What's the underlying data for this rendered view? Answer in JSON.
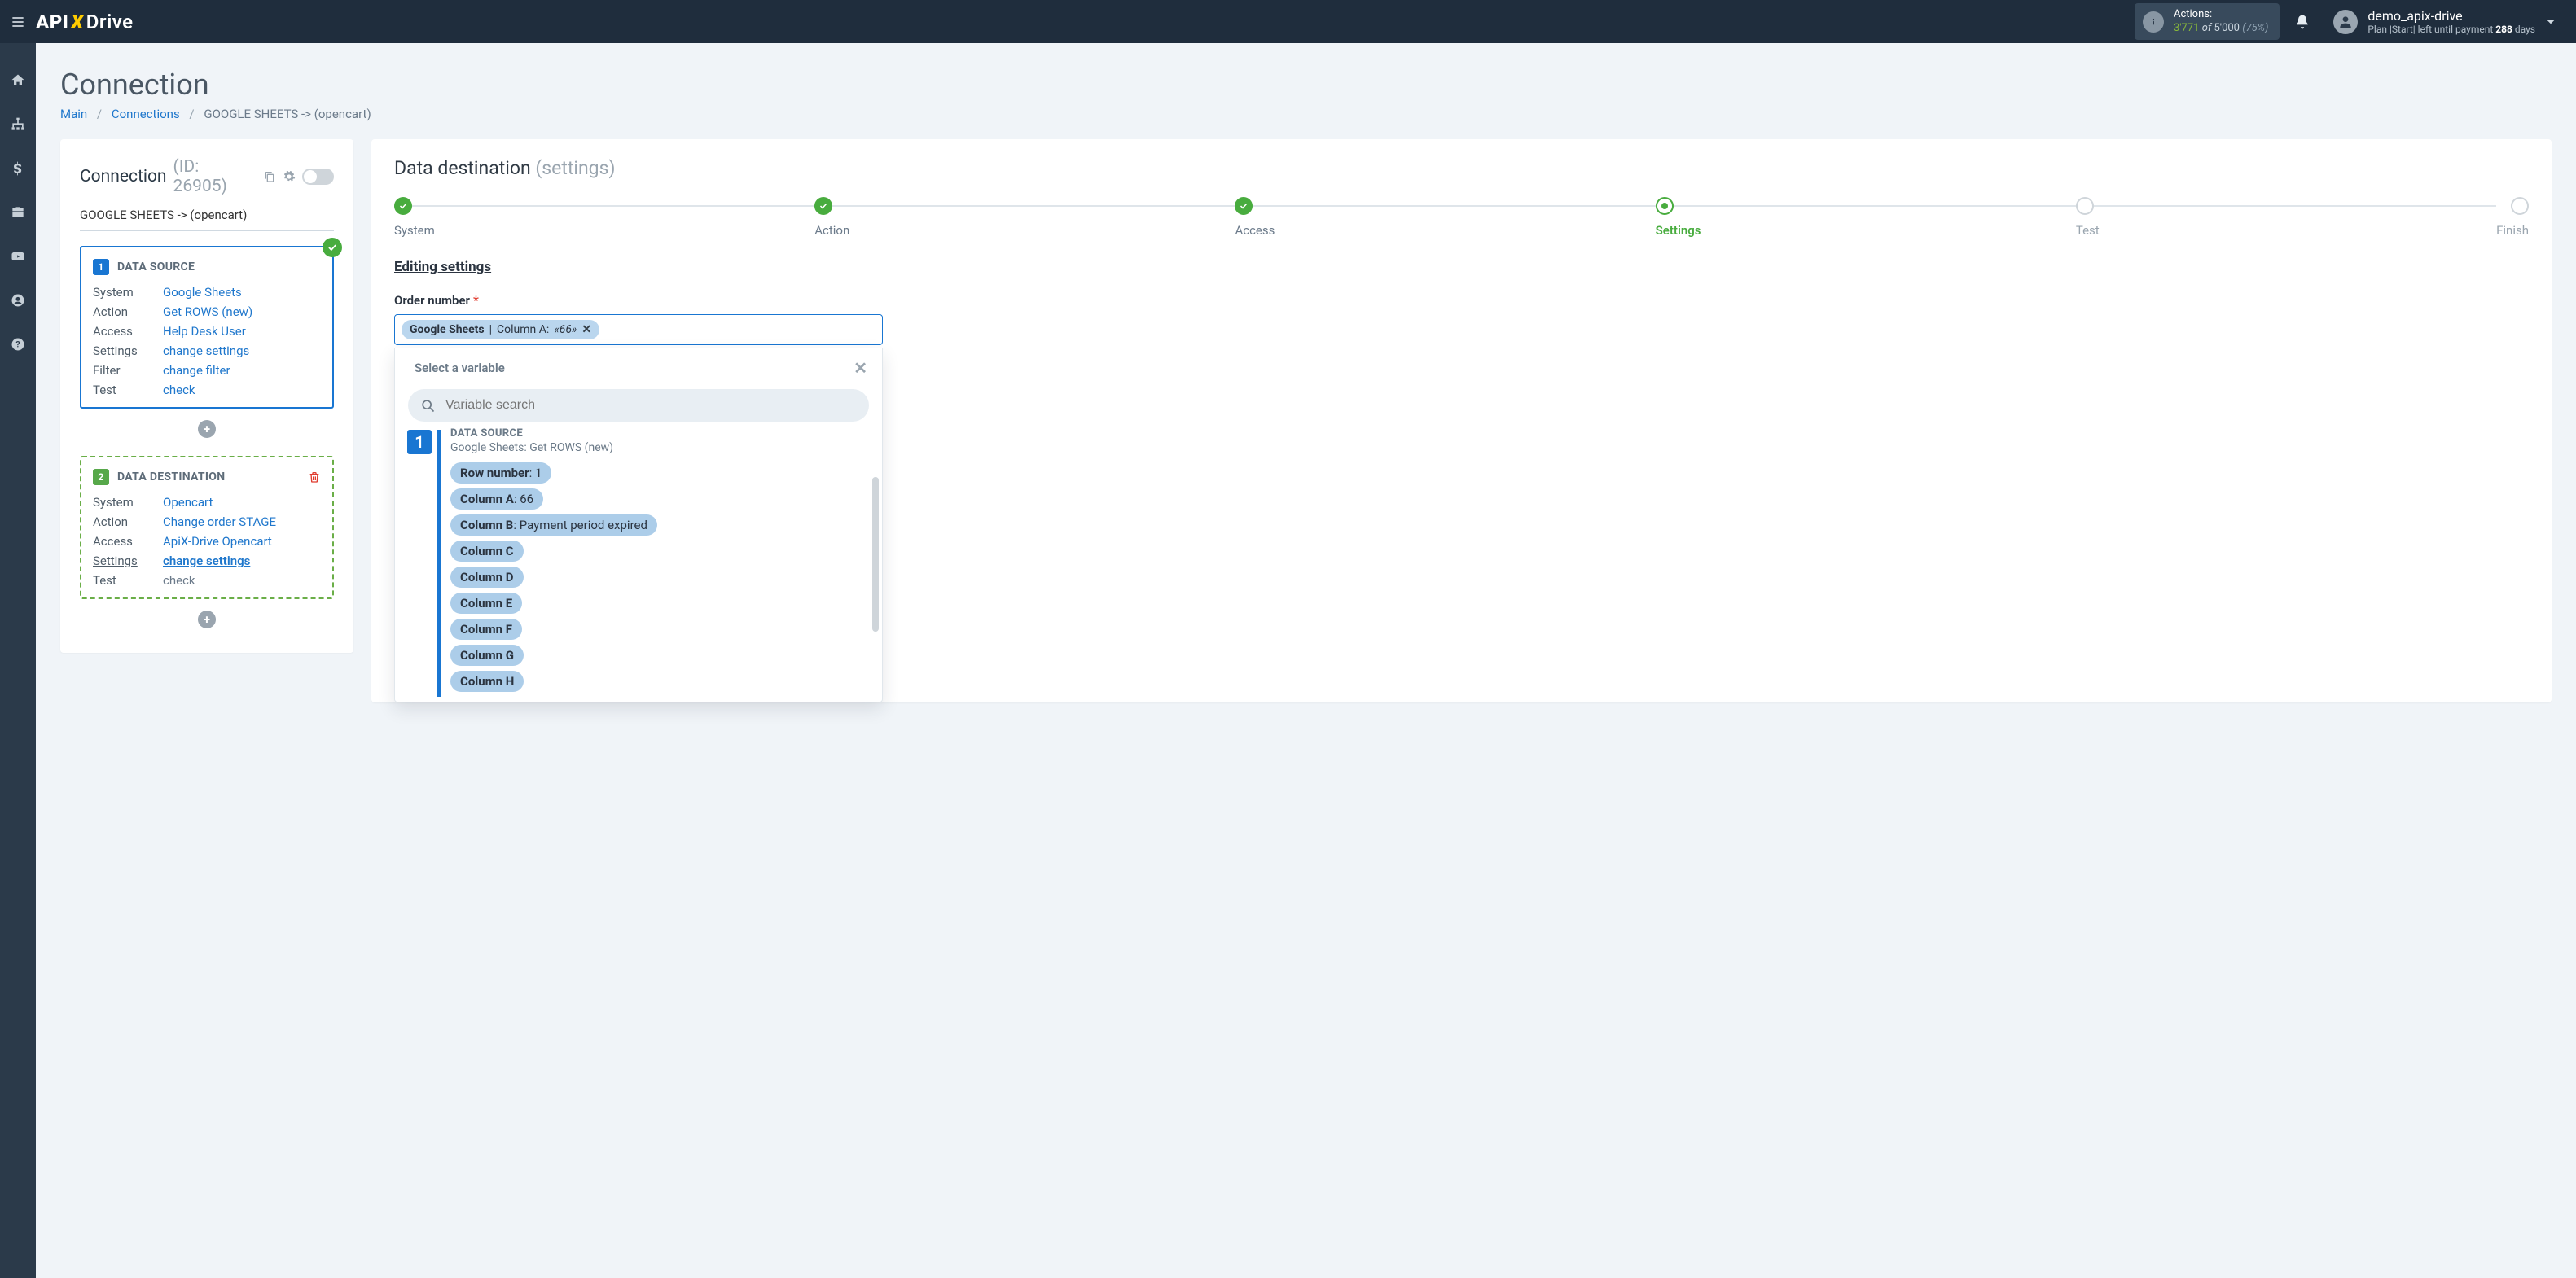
{
  "header": {
    "actions_label": "Actions:",
    "actions_used": "3'771",
    "actions_of": " of ",
    "actions_total": "5'000",
    "actions_pct": "(75%)",
    "user_name": "demo_apix-drive",
    "plan_prefix": "Plan |Start| left until payment ",
    "plan_days_strong": "288",
    "plan_days_suffix": " days"
  },
  "page": {
    "title": "Connection",
    "crumb_main": "Main",
    "crumb_connections": "Connections",
    "crumb_current": "GOOGLE SHEETS -> (opencart)"
  },
  "left": {
    "head_label": "Connection",
    "head_id": "(ID: 26905)",
    "path": "GOOGLE SHEETS -> (opencart)",
    "source": {
      "badge": "1",
      "title": "DATA SOURCE",
      "rows": {
        "system_k": "System",
        "system_v": "Google Sheets",
        "action_k": "Action",
        "action_v": "Get ROWS (new)",
        "access_k": "Access",
        "access_v": "Help Desk User",
        "settings_k": "Settings",
        "settings_v": "change settings",
        "filter_k": "Filter",
        "filter_v": "change filter",
        "test_k": "Test",
        "test_v": "check"
      }
    },
    "dest": {
      "badge": "2",
      "title": "DATA DESTINATION",
      "rows": {
        "system_k": "System",
        "system_v": "Opencart",
        "action_k": "Action",
        "action_v": "Change order STAGE",
        "access_k": "Access",
        "access_v": "ApiX-Drive Opencart",
        "settings_k": "Settings",
        "settings_v": "change settings",
        "test_k": "Test",
        "test_v": "check"
      }
    }
  },
  "right": {
    "title_main": "Data destination",
    "title_sub": "(settings)",
    "steps": {
      "system": "System",
      "action": "Action",
      "access": "Access",
      "settings": "Settings",
      "test": "Test",
      "finish": "Finish"
    },
    "editing": "Editing settings",
    "field_label": "Order number",
    "token_source": "Google Sheets",
    "token_sep": " | ",
    "token_col": "Column A: ",
    "token_val": "«66»",
    "dropdown": {
      "head": "Select a variable",
      "search_placeholder": "Variable search",
      "ds_caption": "DATA SOURCE",
      "ds_sub": "Google Sheets: Get ROWS (new)",
      "vars": [
        {
          "name": "Row number",
          "val": ": 1"
        },
        {
          "name": "Column A",
          "val": ": 66"
        },
        {
          "name": "Column B",
          "val": ": Payment period expired"
        },
        {
          "name": "Column C",
          "val": ""
        },
        {
          "name": "Column D",
          "val": ""
        },
        {
          "name": "Column E",
          "val": ""
        },
        {
          "name": "Column F",
          "val": ""
        },
        {
          "name": "Column G",
          "val": ""
        },
        {
          "name": "Column H",
          "val": ""
        }
      ]
    }
  }
}
